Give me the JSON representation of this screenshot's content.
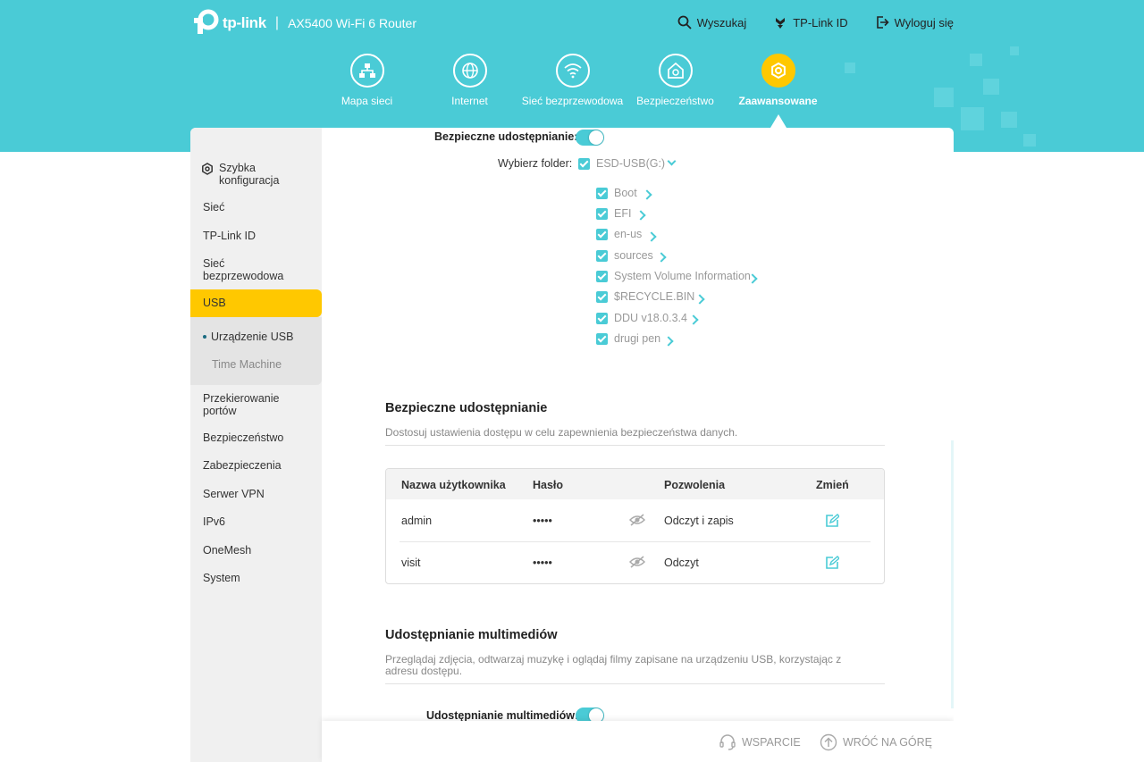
{
  "header": {
    "brand": "tp-link",
    "separator": "|",
    "model": "AX5400 Wi-Fi 6 Router",
    "actions": [
      {
        "label": "Wyszukaj",
        "icon": "search-icon"
      },
      {
        "label": "TP-Link ID",
        "icon": "tplink-id-icon"
      },
      {
        "label": "Wyloguj się",
        "icon": "logout-icon"
      }
    ],
    "nav": [
      {
        "label": "Mapa sieci",
        "icon": "network-map-icon"
      },
      {
        "label": "Internet",
        "icon": "globe-icon"
      },
      {
        "label": "Sieć bezprzewodowa",
        "icon": "wifi-icon"
      },
      {
        "label": "Bezpieczeństwo",
        "icon": "home-shield-icon"
      },
      {
        "label": "Zaawansowane",
        "icon": "gear-icon",
        "active": true
      }
    ]
  },
  "sidebar": {
    "quick_setup": "Szybka konfiguracja",
    "items": [
      "Sieć",
      "TP-Link ID",
      "Sieć bezprzewodowa",
      "USB"
    ],
    "usb_sub": [
      "Urządzenie USB",
      "Time Machine"
    ],
    "items_after": [
      "Przekierowanie portów",
      "Bezpieczeństwo",
      "Zabezpieczenia",
      "Serwer VPN",
      "IPv6",
      "OneMesh",
      "System"
    ]
  },
  "main": {
    "secure_sharing_label": "Bezpieczne udostępnianie:",
    "choose_folder_label": "Wybierz folder:",
    "drive": "ESD-USB(G:)",
    "folders": [
      "Boot",
      "EFI",
      "en-us",
      "sources",
      "System Volume Information",
      "$RECYCLE.BIN",
      "DDU v18.0.3.4",
      "drugi pen"
    ],
    "secure_section": {
      "title": "Bezpieczne udostępnianie",
      "desc": "Dostosuj ustawienia dostępu w celu zapewnienia bezpieczeństwa danych."
    },
    "table": {
      "headers": [
        "Nazwa użytkownika",
        "Hasło",
        "Pozwolenia",
        "Zmień"
      ],
      "rows": [
        {
          "user": "admin",
          "password": "•••••",
          "permission": "Odczyt i zapis"
        },
        {
          "user": "visit",
          "password": "•••••",
          "permission": "Odczyt"
        }
      ]
    },
    "media_section": {
      "title": "Udostępnianie multimediów",
      "desc": "Przeglądaj zdjęcia, odtwarzaj muzykę i oglądaj filmy zapisane na urządzeniu USB, korzystając z adresu dostępu.",
      "toggle_label": "Udostępnianie multimediów:"
    }
  },
  "footer": {
    "support": "WSPARCIE",
    "back_to_top": "WRÓĆ NA GÓRĘ"
  },
  "colors": {
    "accent": "#4acbd6",
    "active": "#ffc800"
  }
}
